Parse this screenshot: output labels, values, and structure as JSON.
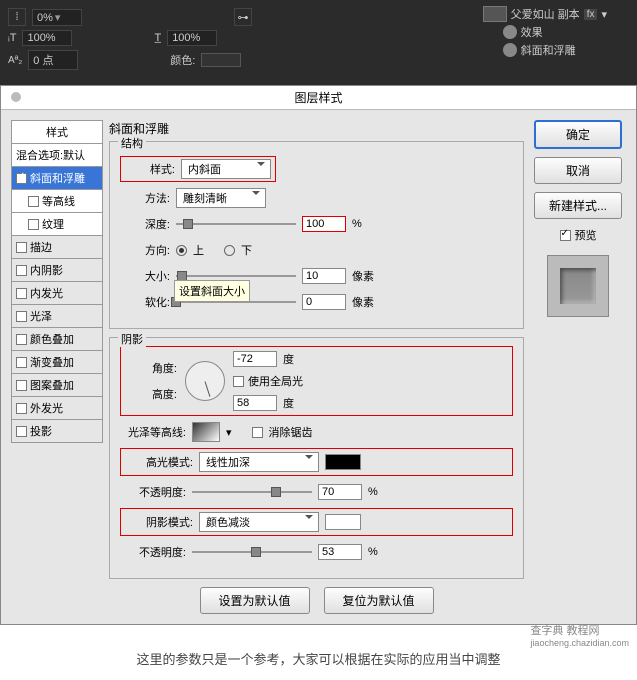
{
  "topbar": {
    "opacity": "0%",
    "row2_left": "100%",
    "row2_right": "100%",
    "aa_value": "0 点",
    "color_label": "颜色:",
    "layer_name": "父爱如山 副本",
    "fx_label": "fx",
    "effects_label": "效果",
    "effect_item": "斜面和浮雕"
  },
  "dialog": {
    "title": "图层样式",
    "styles_header": "样式",
    "blend_options": "混合选项:默认",
    "items": {
      "bevel": "斜面和浮雕",
      "contour": "等高线",
      "texture": "纹理",
      "stroke": "描边",
      "inner_shadow": "内阴影",
      "inner_glow": "内发光",
      "satin": "光泽",
      "color_overlay": "颜色叠加",
      "gradient_overlay": "渐变叠加",
      "pattern_overlay": "图案叠加",
      "outer_glow": "外发光",
      "drop_shadow": "投影"
    },
    "section_bevel": "斜面和浮雕",
    "structure": {
      "legend": "结构",
      "style_label": "样式:",
      "style_value": "内斜面",
      "technique_label": "方法:",
      "technique_value": "雕刻清晰",
      "depth_label": "深度:",
      "depth_value": "100",
      "depth_unit": "%",
      "direction_label": "方向:",
      "direction_up": "上",
      "direction_down": "下",
      "size_label": "大小:",
      "size_value": "10",
      "size_unit": "像素",
      "soften_label": "软化:",
      "soften_value": "0",
      "soften_unit": "像素",
      "tooltip": "设置斜面大小"
    },
    "shading": {
      "legend": "阴影",
      "angle_label": "角度:",
      "angle_value": "-72",
      "angle_unit": "度",
      "global_light": "使用全局光",
      "altitude_label": "高度:",
      "altitude_value": "58",
      "altitude_unit": "度",
      "gloss_label": "光泽等高线:",
      "antialias": "消除锯齿",
      "highlight_mode_label": "高光模式:",
      "highlight_mode_value": "线性加深",
      "highlight_color": "#000000",
      "highlight_opacity_label": "不透明度:",
      "highlight_opacity_value": "70",
      "highlight_opacity_unit": "%",
      "shadow_mode_label": "阴影模式:",
      "shadow_mode_value": "颜色减淡",
      "shadow_color": "#ffffff",
      "shadow_opacity_label": "不透明度:",
      "shadow_opacity_value": "53",
      "shadow_opacity_unit": "%"
    },
    "btn_default": "设置为默认值",
    "btn_reset": "复位为默认值",
    "ok": "确定",
    "cancel": "取消",
    "new_style": "新建样式...",
    "preview": "预览"
  },
  "note": "这里的参数只是一个参考，大家可以根据在实际的应用当中调整",
  "watermark": {
    "line1": "查字典 教程网",
    "line2": "jiaocheng.chazidian.com"
  }
}
